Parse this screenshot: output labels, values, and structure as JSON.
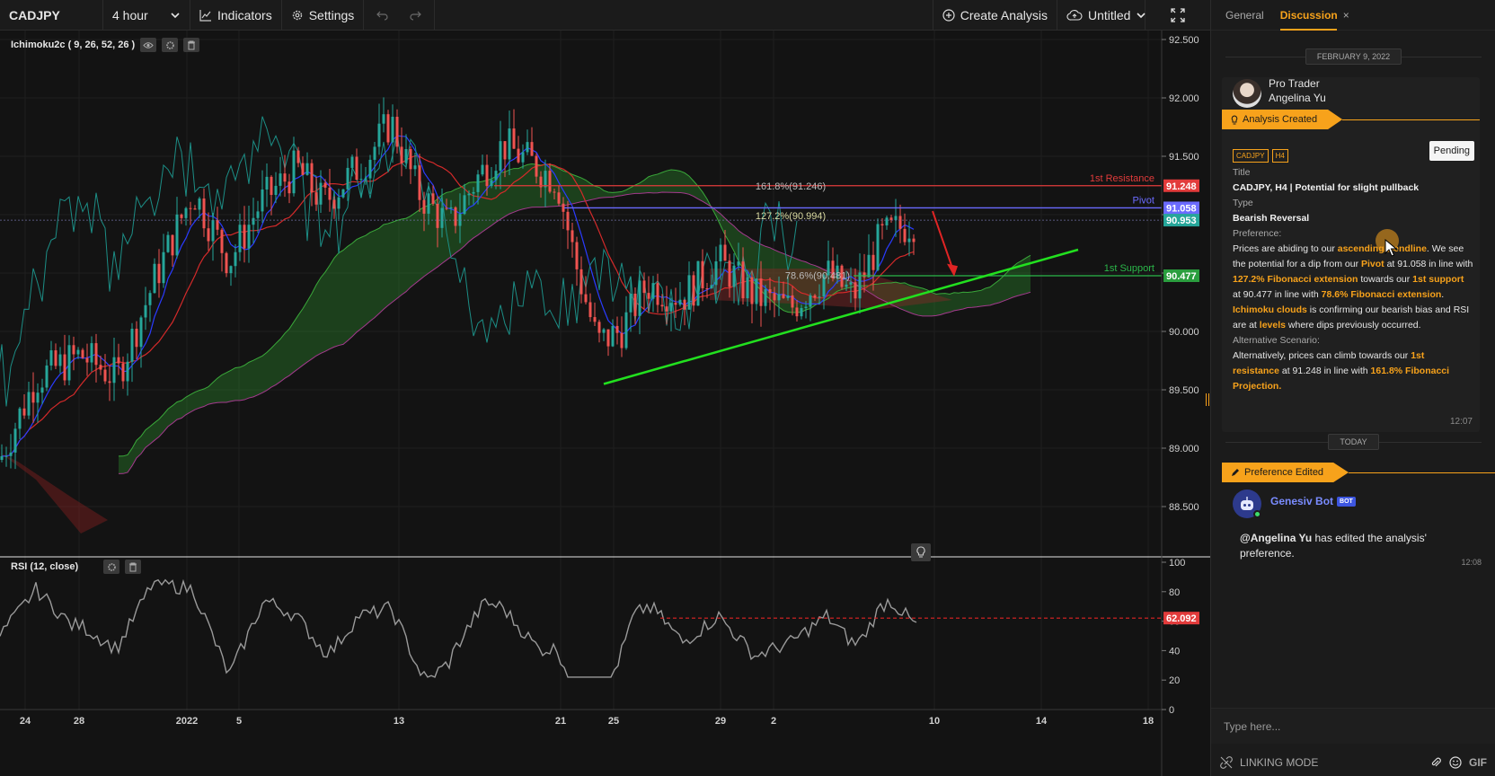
{
  "toolbar": {
    "symbol": "CADJPY",
    "interval": "4 hour",
    "indicators_label": "Indicators",
    "settings_label": "Settings",
    "create_analysis_label": "Create Analysis",
    "layout_name": "Untitled"
  },
  "chart": {
    "main_legend": "Ichimoku2c ( 9, 26, 52, 26 )",
    "rsi_legend": "RSI (12, close)",
    "price_ticks": [
      "92.500",
      "92.000",
      "91.500",
      "91.000",
      "90.500",
      "90.000",
      "89.500",
      "89.000",
      "88.500"
    ],
    "rsi_ticks": [
      "100",
      "80",
      "60",
      "40",
      "20",
      "0"
    ],
    "date_ticks": [
      "24",
      "28",
      "2022",
      "5",
      "13",
      "21",
      "25",
      "29",
      "2",
      "10",
      "14",
      "18"
    ],
    "labels": {
      "resistance": "1st Resistance",
      "pivot": "Pivot",
      "support": "1st Support",
      "fib_1618": "161.8%(91.246)",
      "fib_1272": "127.2%(90.994)",
      "fib_786": "78.6%(90.481)"
    },
    "badges": {
      "resistance": "91.248",
      "pivot": "91.058",
      "last": "90.953",
      "support_hidden": "90.477",
      "support": "90.477",
      "rsi": "62.092"
    },
    "colors": {
      "resistance": "#e23b3b",
      "pivot": "#6b6bff",
      "support": "#2bb84a",
      "trendline": "#22e01f",
      "last": "#26a69a",
      "arrow": "#e02424"
    },
    "chart_data": {
      "type": "line",
      "instrument": "CADJPY",
      "timeframe": "4 hour",
      "ylim": [
        88.2,
        92.5
      ],
      "rsi_ylim": [
        0,
        100
      ],
      "horizontal_levels": [
        {
          "name": "1st Resistance",
          "value": 91.248
        },
        {
          "name": "Pivot",
          "value": 91.058
        },
        {
          "name": "1st Support",
          "value": 90.477
        }
      ],
      "fibonacci": [
        {
          "name": "161.8%",
          "value": 91.246
        },
        {
          "name": "127.2%",
          "value": 90.994
        },
        {
          "name": "78.6%",
          "value": 90.481
        }
      ],
      "last_price": 90.953,
      "rsi_level": 62.092
    }
  },
  "panel": {
    "tabs": {
      "general": "General",
      "discussion": "Discussion",
      "close": "×"
    },
    "date1": "FEBRUARY 9, 2022",
    "date2": "TODAY",
    "author_role": "Pro Trader",
    "author_name": "Angelina Yu",
    "ribbon1": "Analysis Created",
    "tags": [
      "CADJPY",
      "H4"
    ],
    "status": "Pending",
    "title_label": "Title",
    "title_value": "CADJPY, H4 | Potential for slight pullback",
    "type_label": "Type",
    "type_value": "Bearish Reversal",
    "preference_label": "Preference:",
    "preference": [
      "Prices are abiding to our ",
      "ascending trendline",
      ". We see the potential for a dip from our ",
      "Pivot",
      " at 91.058 in line with ",
      "127.2% Fibonacci extension",
      " towards our ",
      "1st support",
      " at 90.477 in line with ",
      "78.6% Fibonacci extension",
      ". ",
      "Ichimoku clouds",
      " is confirming our bearish bias and RSI are at ",
      "levels",
      " where dips previously occurred."
    ],
    "alt_label": "Alternative Scenario:",
    "alternative": [
      "Alternatively, prices can climb towards our ",
      "1st resistance",
      " at 91.248 in line with ",
      "161.8% Fibonacci Projection",
      "."
    ],
    "time1": "12:07",
    "ribbon2": "Preference Edited",
    "bot_name": "Genesiv Bot",
    "bot_badge": "BOT",
    "bot_mention": "@Angelina Yu",
    "bot_text": " has edited the analysis' preference.",
    "time2": "12:08",
    "composer_placeholder": "Type here...",
    "linking_mode": "LINKING MODE",
    "gif": "GIF"
  }
}
